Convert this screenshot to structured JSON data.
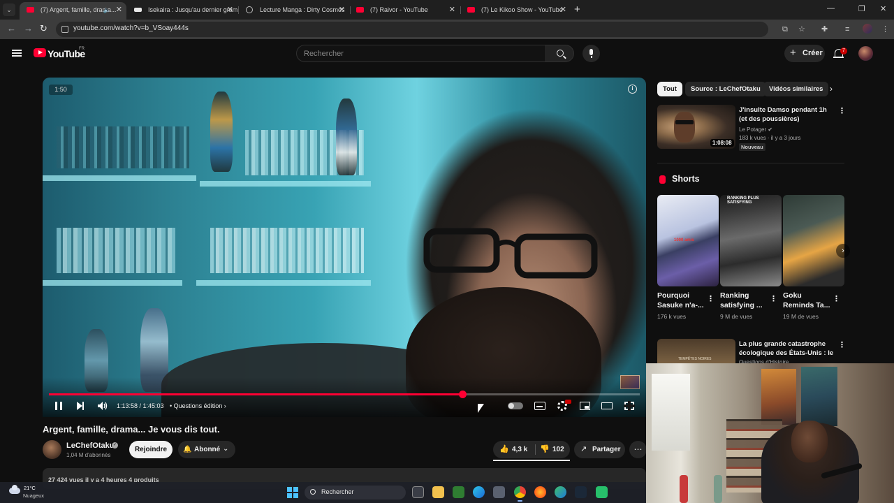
{
  "browser": {
    "tabs": [
      {
        "title": "(7) Argent, famille, drama...",
        "active": true,
        "audio": true
      },
      {
        "title": "Isekaira : Jusqu'au dernier gram",
        "active": false
      },
      {
        "title": "Lecture Manga : Dirty Cosmos",
        "active": false
      },
      {
        "title": "(7) Raivor - YouTube",
        "active": false
      },
      {
        "title": "(7) Le Kikoo Show - YouTube",
        "active": false
      }
    ],
    "url": "youtube.com/watch?v=b_VSoay444s"
  },
  "header": {
    "logo_text": "YouTube",
    "region": "FR",
    "search_placeholder": "Rechercher",
    "create_label": "Créer",
    "notif_count": "7"
  },
  "player": {
    "badge_time": "1:50",
    "current_time": "1:13:58 / 1:45:03",
    "chapter": "Questions édition",
    "progress": 0.7
  },
  "video": {
    "title": "Argent, famille, drama... Je vous dis tout.",
    "channel": "LeChefOtaku",
    "subscribers": "1,04 M d'abonnés",
    "join_label": "Rejoindre",
    "subscribed_label": "Abonné",
    "likes": "4,3 k",
    "dislikes": "102",
    "share_label": "Partager",
    "description_peek": "27 424 vues  il y a 4 heures  4 produits"
  },
  "sidebar": {
    "chips": [
      "Tout",
      "Source : LeChefOtaku",
      "Vidéos similaires"
    ],
    "related": [
      {
        "title": "J'insulte Damso pendant 1h (et des poussières)",
        "channel": "Le Potager",
        "meta": "183 k vues · il y a 3 jours",
        "duration": "1:08:08",
        "badge": "Nouveau"
      },
      {
        "title": "La plus grande catastrophe écologique des États-Unis : le ...",
        "channel": "Questions d'Histoire",
        "thumb_text": "TEMPÊTES NOIRES"
      }
    ],
    "shorts_title": "Shorts",
    "shorts": [
      {
        "title": "Pourquoi Sasuke n'a-...",
        "views": "176 k vues",
        "overlay": "1000 amis"
      },
      {
        "title": "Ranking satisfying ...",
        "views": "9 M de vues",
        "overlay": "RANKING PLUS SATISFYING"
      },
      {
        "title": "Goku Reminds Ta...",
        "views": "19 M de vues"
      }
    ]
  },
  "taskbar": {
    "temperature": "21°C",
    "weather": "Nuageux",
    "search_label": "Rechercher"
  },
  "colors": {
    "accent": "#ff0033",
    "background": "#0f0f0f",
    "surface": "#272727"
  }
}
